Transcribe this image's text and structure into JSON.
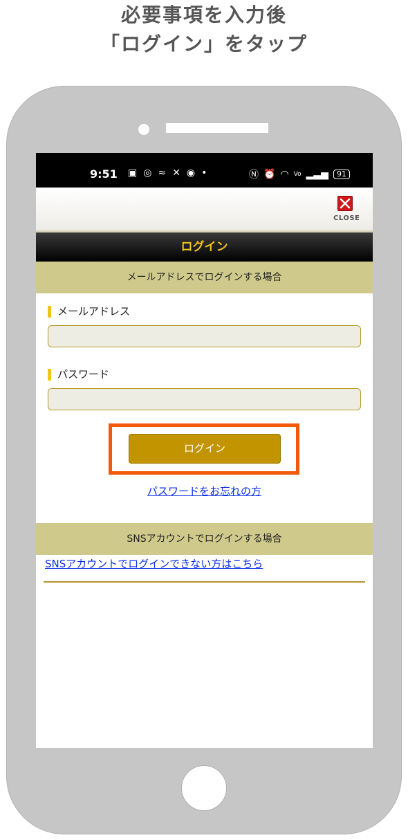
{
  "caption": {
    "line1": "必要事項を入力後",
    "line2": "「ログイン」をタップ"
  },
  "status_bar": {
    "time": "9:51",
    "battery": "91",
    "left_icons": [
      "teams-icon",
      "instagram-icon",
      "app-icon",
      "x-icon",
      "app-icon",
      "dot-icon"
    ],
    "right_icons": [
      "nfc-icon",
      "alarm-icon",
      "wifi-icon",
      "volte-icon",
      "signal-icon",
      "battery-icon"
    ]
  },
  "app_bar": {
    "close_label": "CLOSE"
  },
  "page": {
    "title": "ログイン"
  },
  "email_section": {
    "heading": "メールアドレスでログインする場合",
    "email_label": "メールアドレス",
    "email_value": "",
    "password_label": "パスワード",
    "password_value": "",
    "login_button": "ログイン",
    "forgot_link": "パスワードをお忘れの方"
  },
  "sns_section": {
    "heading": "SNSアカウントでログインする場合",
    "help_link": "SNSアカウントでログインできない方はこちら"
  },
  "colors": {
    "accent_gold": "#c29400",
    "section_bg": "#cfca8b",
    "title_text": "#f3c21b",
    "highlight": "#f05a0a",
    "link": "#0a2ee6"
  }
}
